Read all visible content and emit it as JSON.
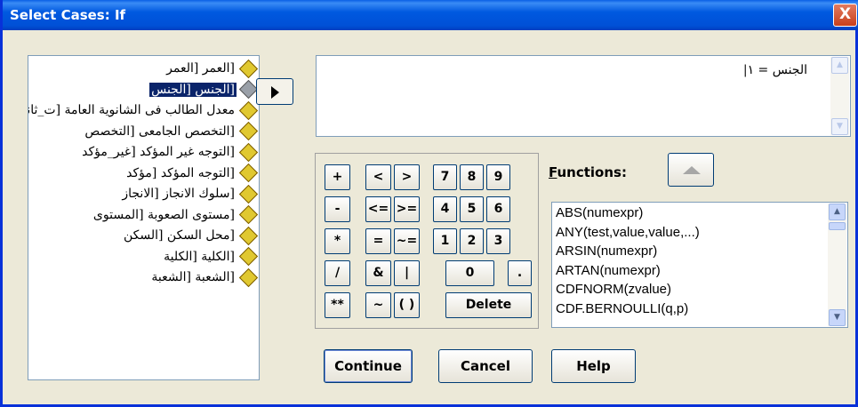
{
  "window": {
    "title": "Select Cases: If",
    "close_label": "X"
  },
  "variables": [
    {
      "label": "[العمر [العمر",
      "selected": false
    },
    {
      "label": "[الجنس [الجنس",
      "selected": true
    },
    {
      "label": "معدل الطالب فى الشانوية العامة [ت_ثانوى",
      "selected": false
    },
    {
      "label": "[التخصص الجامعى [التخصص",
      "selected": false
    },
    {
      "label": "[التوجه غير المؤكد [غير_مؤكد",
      "selected": false
    },
    {
      "label": "[التوجه المؤكد [مؤكد",
      "selected": false
    },
    {
      "label": "[سلوك الانجاز [الانجاز",
      "selected": false
    },
    {
      "label": "[مستوى الصعوبة [المستوى",
      "selected": false
    },
    {
      "label": "[محل السكن [السكن",
      "selected": false
    },
    {
      "label": "[الكلية [الكلية",
      "selected": false
    },
    {
      "label": "[الشعبة [الشعبة",
      "selected": false
    }
  ],
  "expression": "الجنس = ١|",
  "keypad": {
    "plus": "+",
    "lt": "<",
    "gt": ">",
    "k7": "7",
    "k8": "8",
    "k9": "9",
    "minus": "-",
    "le": "<=",
    "ge": ">=",
    "k4": "4",
    "k5": "5",
    "k6": "6",
    "times": "*",
    "eq": "=",
    "ne": "~=",
    "k1": "1",
    "k2": "2",
    "k3": "3",
    "div": "/",
    "and": "&",
    "or": "|",
    "k0": "0",
    "dot": ".",
    "pow": "**",
    "not": "~",
    "paren": "( )",
    "del": "Delete"
  },
  "functions": {
    "label_u": "F",
    "label_rest": "unctions:",
    "items": [
      "ABS(numexpr)",
      "ANY(test,value,value,...)",
      "ARSIN(numexpr)",
      "ARTAN(numexpr)",
      "CDFNORM(zvalue)",
      "CDF.BERNOULLI(q,p)"
    ]
  },
  "buttons": {
    "continue": "Continue",
    "cancel": "Cancel",
    "help": "Help"
  },
  "colors": {
    "titlebar": "#0054e3",
    "face": "#ece9d8",
    "selection": "#0a246a"
  }
}
